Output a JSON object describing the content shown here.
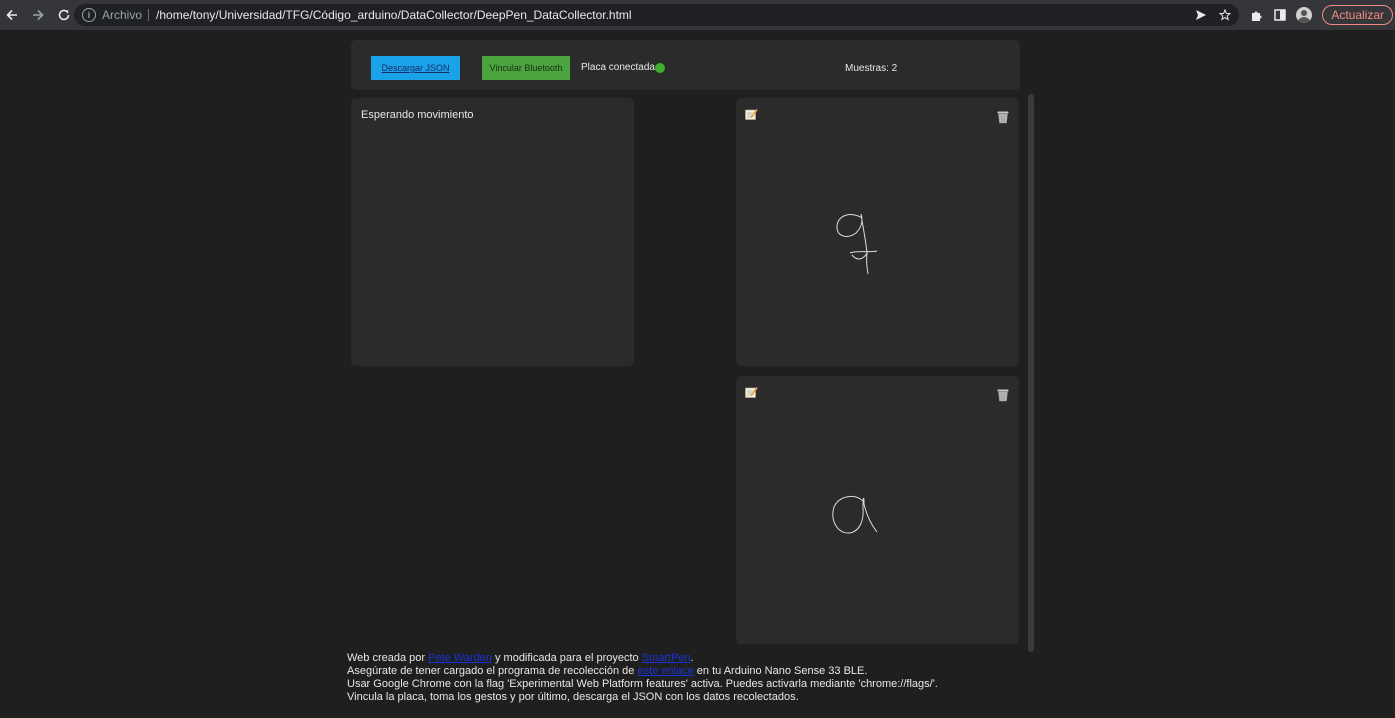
{
  "browser": {
    "scheme_label": "Archivo",
    "url": "/home/tony/Universidad/TFG/Código_arduino/DataCollector/DeepPen_DataCollector.html",
    "update_label": "Actualizar"
  },
  "toolbar": {
    "download_label": "Descargar JSON",
    "bluetooth_label": "Vincular Bluetooth",
    "status_label": "Placa conectada",
    "status_color": "#3fae2c",
    "samples_label": "Muestras: 2"
  },
  "live": {
    "label": "Esperando movimiento"
  },
  "samples": [
    {
      "edit_icon": "edit-icon",
      "delete_icon": "trash-icon"
    },
    {
      "edit_icon": "edit-icon",
      "delete_icon": "trash-icon"
    }
  ],
  "footer": {
    "line1_a": "Web creada por ",
    "line1_link1": "Pete Warden",
    "line1_b": " y modificada para el proyecto ",
    "line1_link2": "SmartPen",
    "line1_c": ".",
    "line2_a": "Asegúrate de tener cargado el programa de recolección de ",
    "line2_link": "este enlace",
    "line2_b": " en tu Arduino Nano Sense 33 BLE.",
    "line3": "Usar Google Chrome con la flag 'Experimental Web Platform features' activa. Puedes activarla mediante 'chrome://flags/'.",
    "line4": "Vincula la placa, toma los gestos y por último, descarga el JSON con los datos recolectados."
  },
  "colors": {
    "download_button": "#1aa3e8",
    "bluetooth_button": "#4aa33f",
    "link": "#1a33d6"
  }
}
